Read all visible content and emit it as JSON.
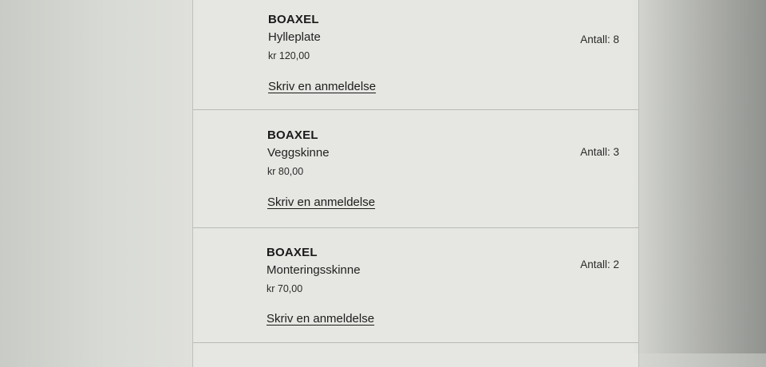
{
  "order": {
    "items": [
      {
        "brand": "BOAXEL",
        "name": "Hylleplate",
        "price": "kr 120,00",
        "quantity": "Antall: 8",
        "review_link": "Skriv en anmeldelse"
      },
      {
        "brand": "BOAXEL",
        "name": "Veggskinne",
        "price": "kr 80,00",
        "quantity": "Antall: 3",
        "review_link": "Skriv en anmeldelse"
      },
      {
        "brand": "BOAXEL",
        "name": "Monteringsskinne",
        "price": "kr 70,00",
        "quantity": "Antall: 2",
        "review_link": "Skriv en anmeldelse"
      }
    ]
  }
}
